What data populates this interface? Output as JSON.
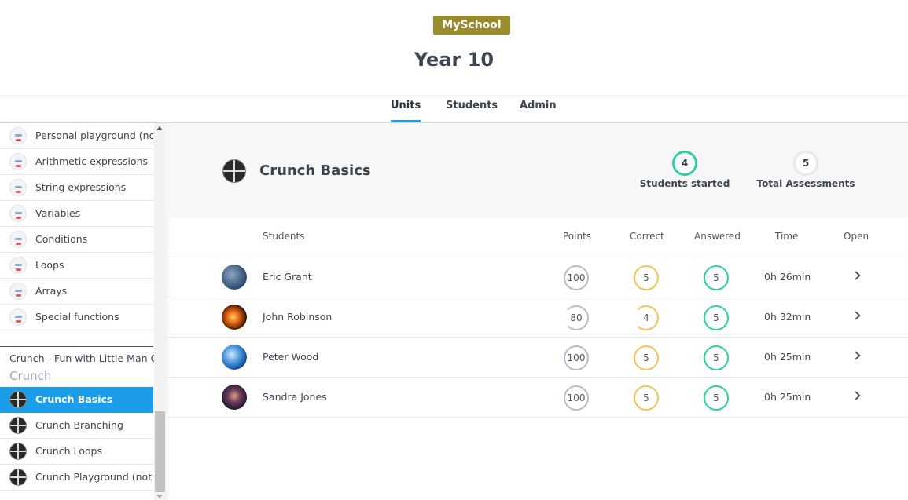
{
  "header": {
    "school": "MySchool",
    "title": "Year 10"
  },
  "tabs": [
    {
      "label": "Units",
      "active": true
    },
    {
      "label": "Students",
      "active": false
    },
    {
      "label": "Admin",
      "active": false
    }
  ],
  "sidebar": {
    "items": [
      {
        "label": "Personal playground (not",
        "icon": "robot-icon"
      },
      {
        "label": "Arithmetic expressions",
        "icon": "robot-icon"
      },
      {
        "label": "String expressions",
        "icon": "robot-icon"
      },
      {
        "label": "Variables",
        "icon": "robot-icon"
      },
      {
        "label": "Conditions",
        "icon": "robot-icon"
      },
      {
        "label": "Loops",
        "icon": "robot-icon"
      },
      {
        "label": "Arrays",
        "icon": "robot-icon"
      },
      {
        "label": "Special functions",
        "icon": "robot-icon"
      }
    ],
    "group_title": "Crunch - Fun with Little Man C...",
    "group_subtitle": "Crunch",
    "crunch_items": [
      {
        "label": "Crunch Basics",
        "selected": true
      },
      {
        "label": "Crunch Branching",
        "selected": false
      },
      {
        "label": "Crunch Loops",
        "selected": false
      },
      {
        "label": "Crunch Playground (not a",
        "selected": false
      }
    ]
  },
  "unit": {
    "title": "Crunch Basics",
    "students_started": "4",
    "students_started_label": "Students started",
    "total_assessments": "5",
    "total_assessments_label": "Total Assessments"
  },
  "table": {
    "headers": {
      "students": "Students",
      "points": "Points",
      "correct": "Correct",
      "answered": "Answered",
      "time": "Time",
      "open": "Open"
    },
    "rows": [
      {
        "name": "Eric Grant",
        "points": "100",
        "correct": "5",
        "answered": "5",
        "time": "0h 26min",
        "avatar_color": "#4a6a8c"
      },
      {
        "name": "John Robinson",
        "points": "80",
        "correct": "4",
        "answered": "5",
        "time": "0h 32min",
        "avatar_color": "#b84a10"
      },
      {
        "name": "Peter Wood",
        "points": "100",
        "correct": "5",
        "answered": "5",
        "time": "0h 25min",
        "avatar_color": "#2a7fd0"
      },
      {
        "name": "Sandra Jones",
        "points": "100",
        "correct": "5",
        "answered": "5",
        "time": "0h 25min",
        "avatar_color": "#2a2440"
      }
    ]
  },
  "colors": {
    "accent": "#1b9dea",
    "badge": "#9a8c2c",
    "correct": "#f2c55c",
    "answered": "#2fd1a0",
    "points": "#b8bec6"
  }
}
